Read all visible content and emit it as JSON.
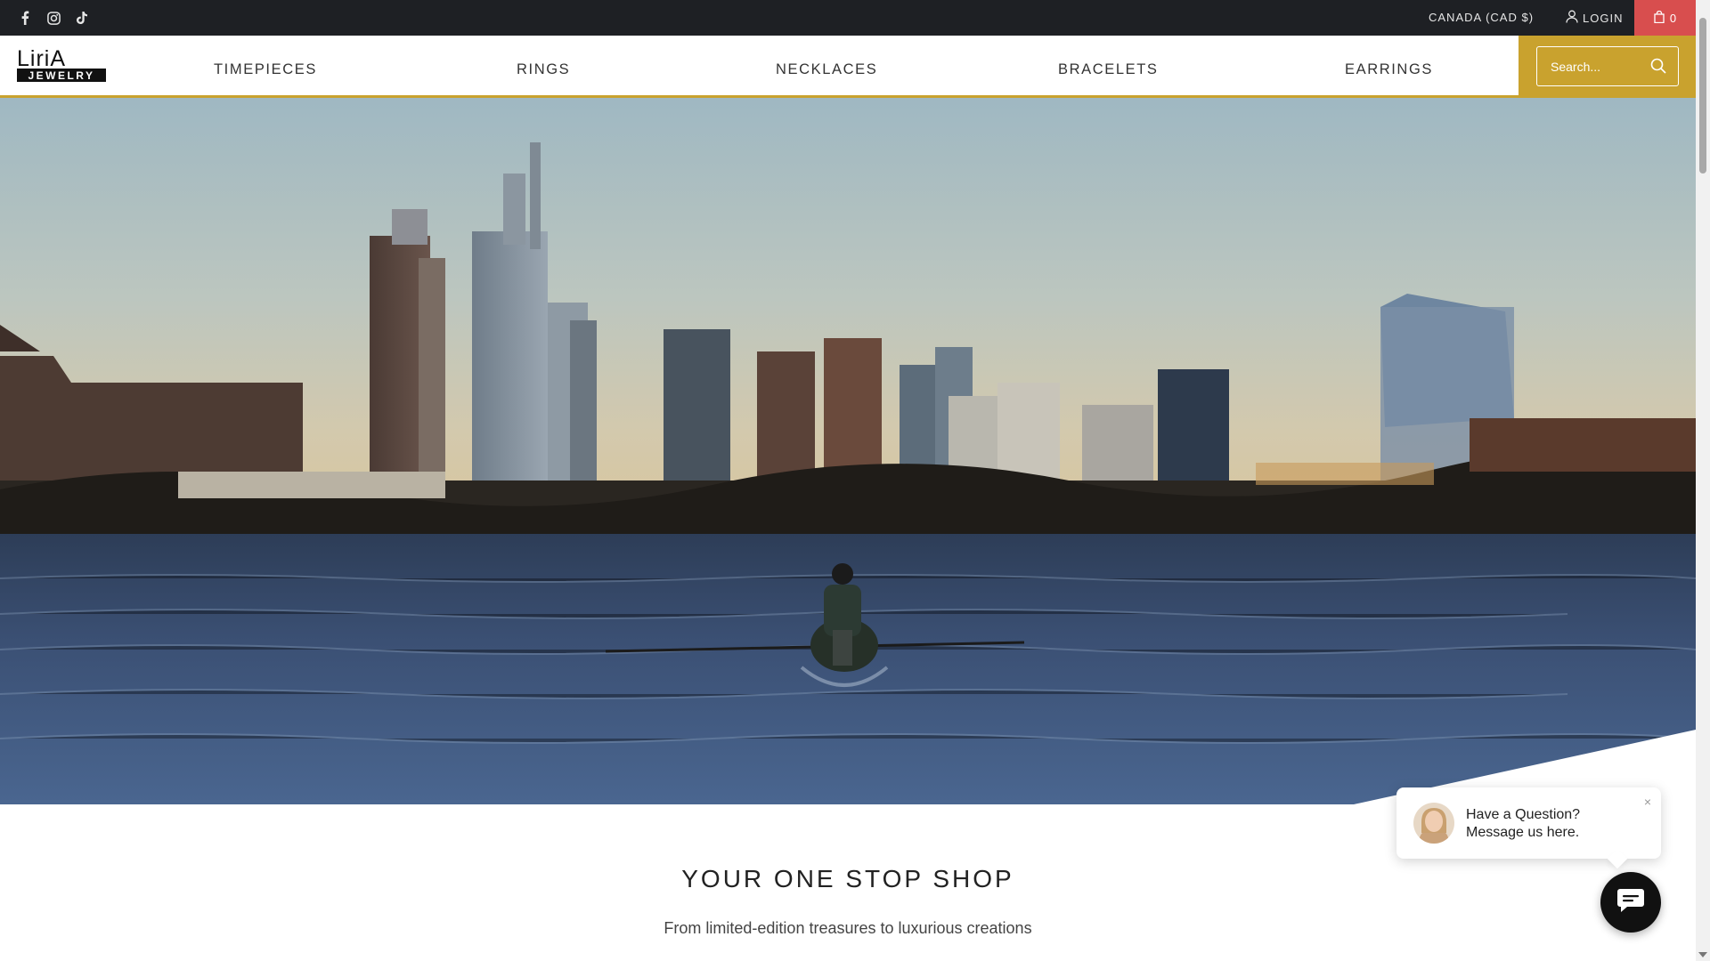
{
  "topbar": {
    "social": [
      {
        "icon": "facebook-icon"
      },
      {
        "icon": "instagram-icon"
      },
      {
        "icon": "tiktok-icon"
      }
    ],
    "currency": "CANADA (CAD $)",
    "login": "LOGIN",
    "cart_count": "0"
  },
  "header": {
    "logo_alt": "Liria Jewelry",
    "logo_top": "LiriA",
    "logo_bottom": "JEWELRY",
    "nav": [
      {
        "label": "TIMEPIECES"
      },
      {
        "label": "RINGS"
      },
      {
        "label": "NECKLACES"
      },
      {
        "label": "BRACELETS"
      },
      {
        "label": "EARRINGS"
      }
    ],
    "search_placeholder": "Search..."
  },
  "hero": {
    "image": "city skyline river rower"
  },
  "section": {
    "title": "YOUR ONE STOP SHOP",
    "subtitle": "From limited-edition treasures to luxurious creations"
  },
  "chat": {
    "line1": "Have a Question?",
    "line2": "Message us here.",
    "close": "×"
  },
  "colors": {
    "topbar_bg": "#1e2024",
    "accent_gold": "#c9a22e",
    "cart_red": "#d84e4e"
  }
}
